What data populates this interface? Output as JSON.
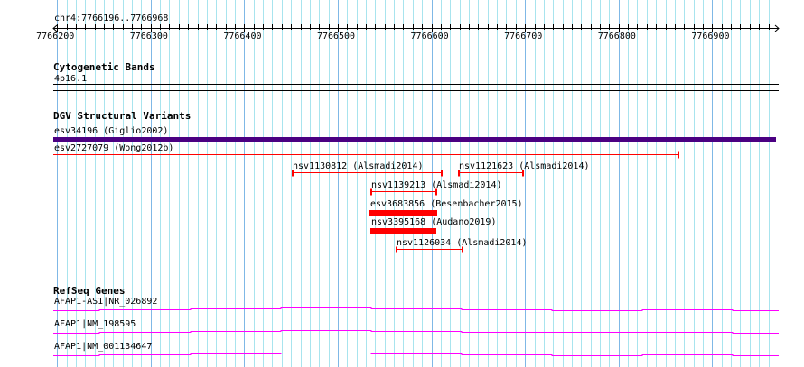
{
  "ruler": {
    "location": "chr4:7766196..7766968",
    "start": 7766196,
    "end": 7766968,
    "ticks": [
      "7766200",
      "7766300",
      "7766400",
      "7766500",
      "7766600",
      "7766700",
      "7766800",
      "7766900"
    ]
  },
  "tracks": {
    "cytobands": {
      "title": "Cytogenetic Bands",
      "band": "4p16.1"
    },
    "dgv": {
      "title": "DGV Structural Variants",
      "features": [
        {
          "label": "esv34196 (Giglio2002)",
          "start": 7766196,
          "end": 7766968,
          "style": "bar",
          "color": "#4b0082"
        },
        {
          "label": "esv2727079 (Wong2012b)",
          "start": 7766196,
          "end": 7766864,
          "style": "line",
          "color": "#ff0000"
        },
        {
          "label": "nsv1130812 (Alsmadi2014)",
          "start": 7766451,
          "end": 7766611,
          "style": "line",
          "color": "#ff0000"
        },
        {
          "label": "nsv1121623 (Alsmadi2014)",
          "start": 7766628,
          "end": 7766698,
          "style": "line",
          "color": "#ff0000"
        },
        {
          "label": "nsv1139213 (Alsmadi2014)",
          "start": 7766535,
          "end": 7766605,
          "style": "line",
          "color": "#ff0000"
        },
        {
          "label": "esv3683856 (Besenbacher2015)",
          "start": 7766534,
          "end": 7766606,
          "style": "bar",
          "color": "#ff0000"
        },
        {
          "label": "nsv3395168 (Audano2019)",
          "start": 7766535,
          "end": 7766605,
          "style": "bar",
          "color": "#ff0000"
        },
        {
          "label": "nsv1126034 (Alsmadi2014)",
          "start": 7766562,
          "end": 7766633,
          "style": "line",
          "color": "#ff0000"
        }
      ]
    },
    "refseq": {
      "title": "RefSeq Genes",
      "color": "#ff00ff",
      "genes": [
        {
          "label": "AFAP1-AS1|NR_026892"
        },
        {
          "label": "AFAP1|NM_198595"
        },
        {
          "label": "AFAP1|NM_001134647"
        }
      ]
    }
  }
}
